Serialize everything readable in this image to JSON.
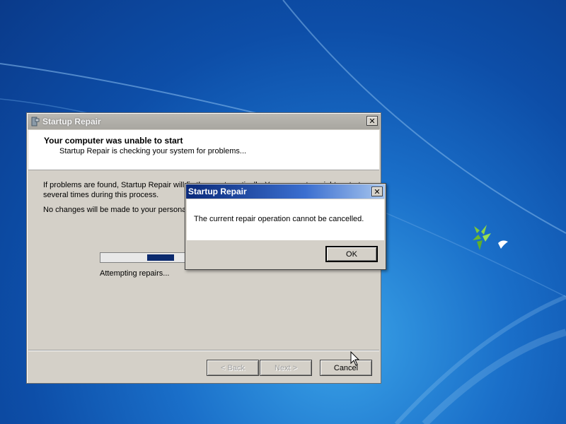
{
  "colors": {
    "desktop_blue": "#1a6fc9",
    "dialog_face": "#d4d0c8",
    "progress_fill": "#0b2a6e",
    "msg_title_start": "#0a2a7a"
  },
  "main_window": {
    "title": "Startup Repair",
    "header_title": "Your computer was unable to start",
    "header_subtitle": "Startup Repair is checking your system for problems...",
    "body_text_1": "If problems are found, Startup Repair will fix them automatically.  Your computer might restart several times during this process.",
    "body_text_2": "No changes will be made to your personal files.",
    "status_text": "Attempting repairs...",
    "progress_mode": "marquee",
    "buttons": {
      "back": "< Back",
      "next": "Next >",
      "cancel": "Cancel"
    },
    "icons": {
      "app": "repair-tool-icon",
      "close": "close-icon"
    }
  },
  "message_box": {
    "title": "Startup Repair",
    "message": "The current repair operation cannot be cancelled.",
    "ok_label": "OK",
    "close_glyph": "✕"
  },
  "main_close_glyph": "✕"
}
